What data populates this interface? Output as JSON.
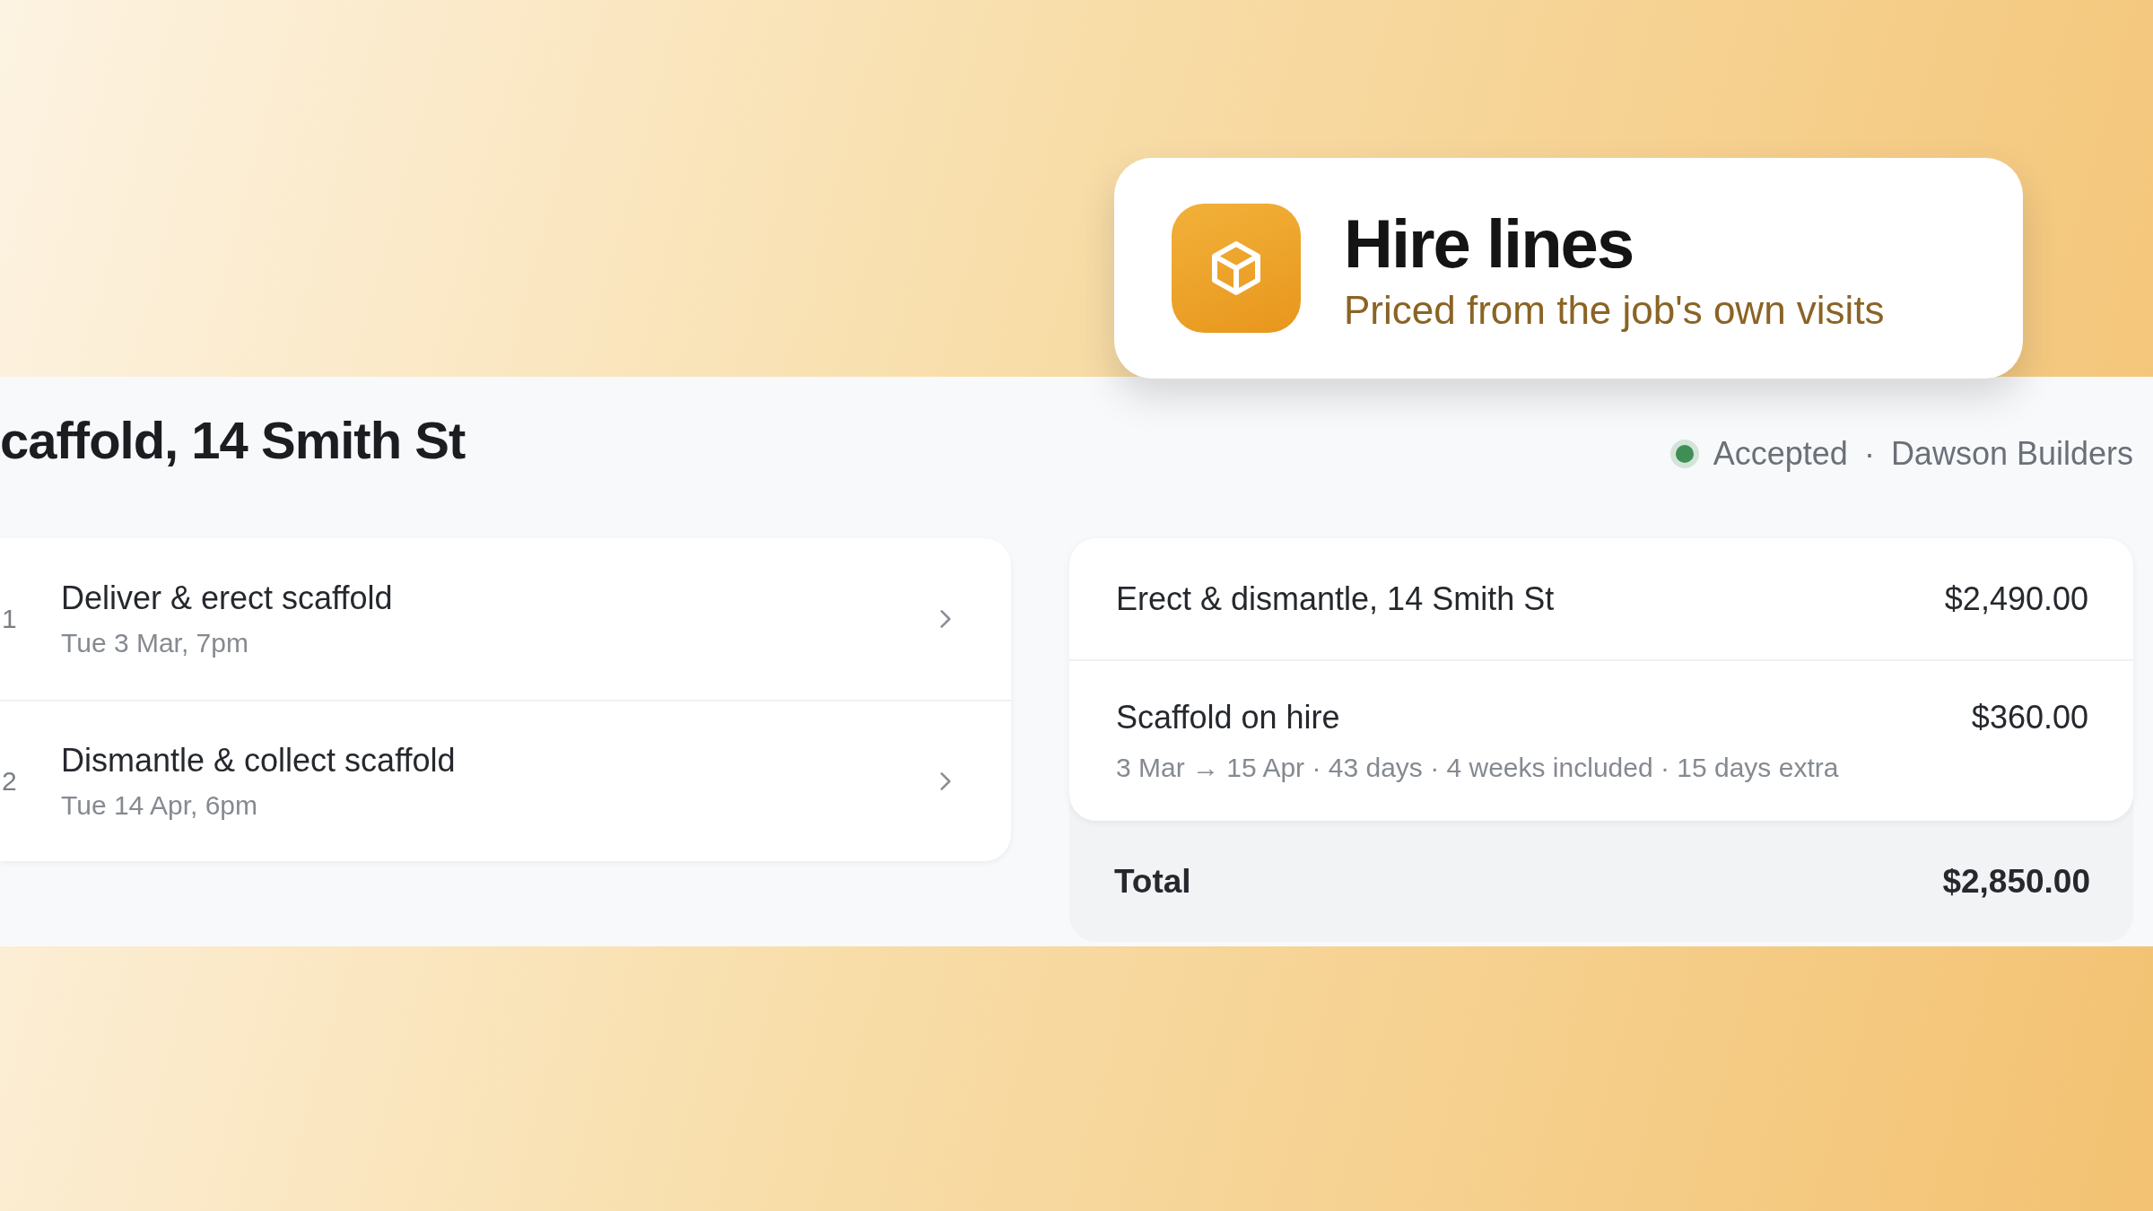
{
  "callout": {
    "title": "Hire lines",
    "subtitle": "Priced from the job's own visits"
  },
  "job": {
    "title": "caffold, 14 Smith St",
    "status": {
      "label": "Accepted",
      "color": "#3f8f55"
    },
    "separator": "·",
    "client": "Dawson Builders"
  },
  "visits": [
    {
      "number": "1",
      "title": "Deliver & erect scaffold",
      "when": "Tue 3 Mar, 7pm"
    },
    {
      "number": "2",
      "title": "Dismantle & collect scaffold",
      "when": "Tue 14 Apr, 6pm"
    }
  ],
  "lines": [
    {
      "title": "Erect & dismantle, 14 Smith St",
      "amount": "$2,490.00"
    },
    {
      "title": "Scaffold on hire",
      "amount": "$360.00",
      "detail": "3 Mar → 15 Apr · 43 days · 4 weeks included · 15 days extra"
    }
  ],
  "total": {
    "label": "Total",
    "amount": "$2,850.00"
  }
}
